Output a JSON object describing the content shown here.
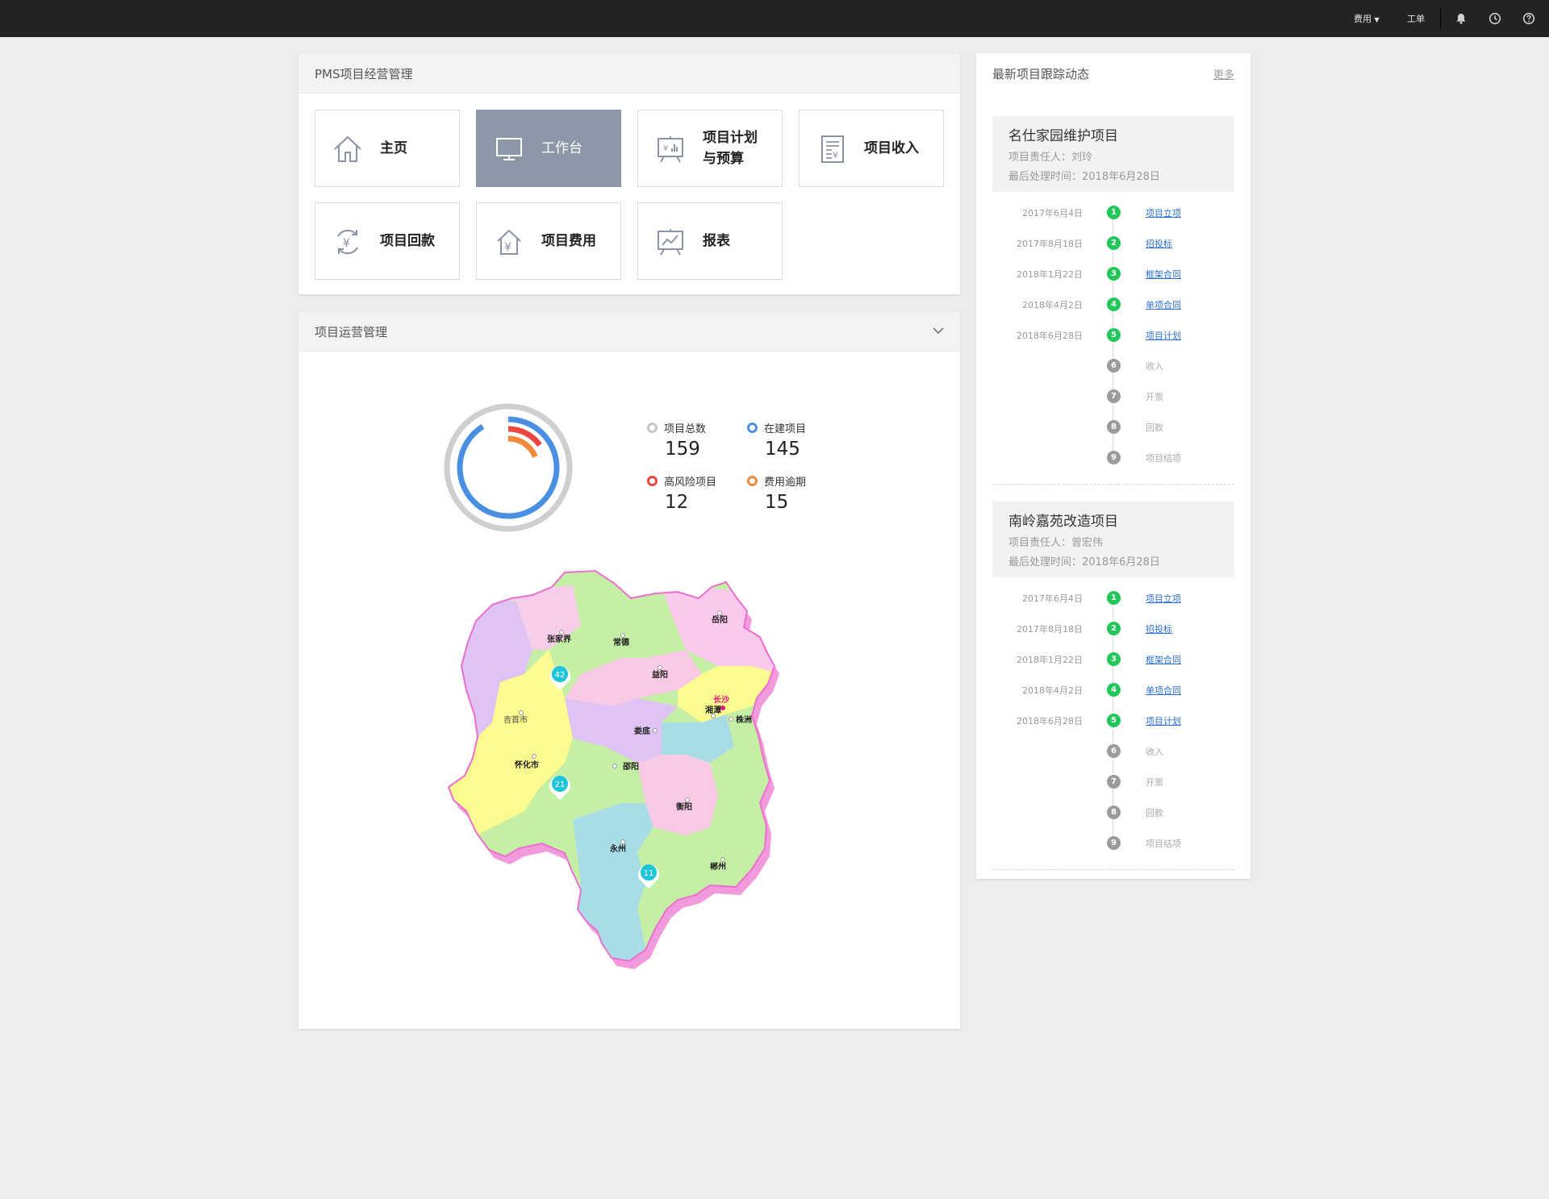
{
  "topbar": {
    "items": [
      {
        "label": "费用"
      },
      {
        "label": "工单"
      }
    ],
    "icons": [
      "bell-icon",
      "clock-icon",
      "help-icon"
    ]
  },
  "pms": {
    "title": "PMS项目经营管理",
    "tiles": [
      {
        "label": "主页",
        "icon": "home-icon",
        "active": false
      },
      {
        "label": "工作台",
        "icon": "monitor-icon",
        "active": true
      },
      {
        "label": "项目计划\n与预算",
        "line1": "项目计划",
        "line2": "与预算",
        "icon": "plan-board-icon",
        "active": false
      },
      {
        "label": "项目收入",
        "icon": "document-yen-icon",
        "active": false
      },
      {
        "label": "项目回款",
        "icon": "yen-cycle-icon",
        "active": false
      },
      {
        "label": "项目费用",
        "icon": "house-yen-icon",
        "active": false
      },
      {
        "label": "报表",
        "icon": "report-chart-icon",
        "active": false
      }
    ]
  },
  "ops": {
    "title": "项目运营管理",
    "stats": [
      {
        "label": "项目总数",
        "value": "159",
        "color": "#c6c6c6"
      },
      {
        "label": "在建项目",
        "value": "145",
        "color": "#4a90e2"
      },
      {
        "label": "高风险项目",
        "value": "12",
        "color": "#e9473f"
      },
      {
        "label": "费用逾期",
        "value": "15",
        "color": "#f0893a"
      }
    ],
    "ring": {
      "total": 159,
      "in_progress": 145,
      "high_risk": 12,
      "overdue": 15
    },
    "map": {
      "cities": [
        "张家界",
        "常德",
        "岳阳",
        "益阳",
        "长沙",
        "吉首市",
        "湘潭",
        "株洲",
        "娄底",
        "怀化市",
        "邵阳",
        "衡阳",
        "永州",
        "郴州"
      ],
      "markers": [
        {
          "value": "42",
          "near": "张家界"
        },
        {
          "value": "21",
          "near": "怀化市"
        },
        {
          "value": "11",
          "near": "永州"
        }
      ]
    }
  },
  "tracking": {
    "title": "最新项目跟踪动态",
    "more": "更多",
    "owner_label": "项目责任人：",
    "time_label": "最后处理时间：",
    "projects": [
      {
        "name": "名仕家园维护项目",
        "owner": "刘玲",
        "last_time": "2018年6月28日",
        "steps": [
          {
            "num": "1",
            "date": "2017年6月4日",
            "name": "项目立项",
            "done": true
          },
          {
            "num": "2",
            "date": "2017年8月18日",
            "name": "招投标",
            "done": true
          },
          {
            "num": "3",
            "date": "2018年1月22日",
            "name": "框架合同",
            "done": true
          },
          {
            "num": "4",
            "date": "2018年4月2日",
            "name": "单项合同",
            "done": true
          },
          {
            "num": "5",
            "date": "2018年6月28日",
            "name": "项目计划",
            "done": true
          },
          {
            "num": "6",
            "date": "",
            "name": "收入",
            "done": false
          },
          {
            "num": "7",
            "date": "",
            "name": "开票",
            "done": false
          },
          {
            "num": "8",
            "date": "",
            "name": "回款",
            "done": false
          },
          {
            "num": "9",
            "date": "",
            "name": "项目结项",
            "done": false
          }
        ]
      },
      {
        "name": "南岭嘉苑改造项目",
        "owner": "曾宏伟",
        "last_time": "2018年6月28日",
        "steps": [
          {
            "num": "1",
            "date": "2017年6月4日",
            "name": "项目立项",
            "done": true
          },
          {
            "num": "2",
            "date": "2017年8月18日",
            "name": "招投标",
            "done": true
          },
          {
            "num": "3",
            "date": "2018年1月22日",
            "name": "框架合同",
            "done": true
          },
          {
            "num": "4",
            "date": "2018年4月2日",
            "name": "单项合同",
            "done": true
          },
          {
            "num": "5",
            "date": "2018年6月28日",
            "name": "项目计划",
            "done": true
          },
          {
            "num": "6",
            "date": "",
            "name": "收入",
            "done": false
          },
          {
            "num": "7",
            "date": "",
            "name": "开票",
            "done": false
          },
          {
            "num": "8",
            "date": "",
            "name": "回款",
            "done": false
          },
          {
            "num": "9",
            "date": "",
            "name": "项目结项",
            "done": false
          }
        ]
      }
    ]
  }
}
